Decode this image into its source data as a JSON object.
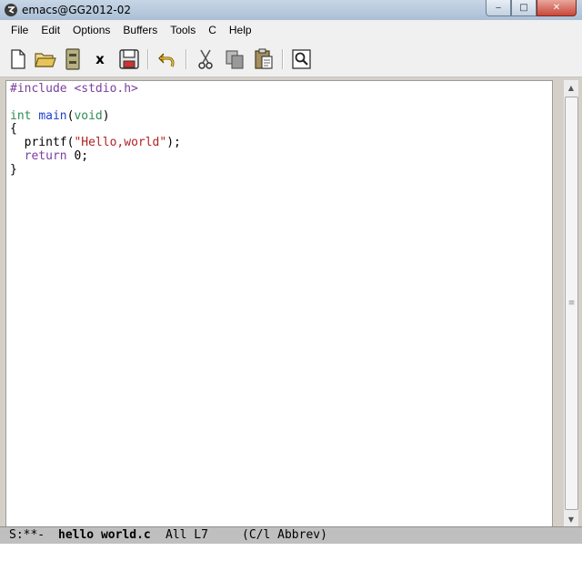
{
  "window": {
    "title": "emacs@GG2012-02",
    "controls": {
      "minimize": "‒",
      "maximize": "□",
      "close": "✕"
    }
  },
  "menubar": {
    "items": [
      "File",
      "Edit",
      "Options",
      "Buffers",
      "Tools",
      "C",
      "Help"
    ]
  },
  "toolbar": {
    "buttons": [
      {
        "icon": "new-file-icon"
      },
      {
        "icon": "open-folder-icon"
      },
      {
        "icon": "open-directory-icon"
      },
      {
        "icon": "close-buffer-icon",
        "glyph": "x"
      },
      {
        "icon": "save-icon"
      },
      {
        "icon": "undo-icon"
      },
      {
        "icon": "cut-icon"
      },
      {
        "icon": "copy-icon"
      },
      {
        "icon": "paste-icon"
      },
      {
        "icon": "search-icon"
      }
    ]
  },
  "editor": {
    "lines": [
      "#include <stdio.h>",
      "",
      "int main(void)",
      "{",
      "  printf(\"Hello,world\");",
      "  return 0;",
      "}"
    ]
  },
  "modeline": {
    "status": "S:**-",
    "buffer": "hello world.c",
    "position": "All L7",
    "mode": "(C/l Abbrev)"
  },
  "minibuffer": {
    "text": ""
  }
}
